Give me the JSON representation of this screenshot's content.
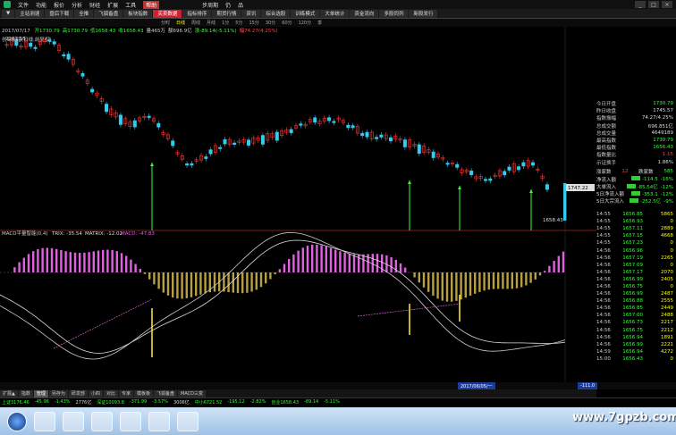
{
  "menubar": {
    "items": [
      "文件",
      "功能",
      "报价",
      "分析",
      "财经",
      "扩展",
      "工具",
      "帮助"
    ],
    "active_item": "帮助",
    "right_items": [
      "步周期",
      "仍",
      "品"
    ],
    "window_controls": [
      "_",
      "□",
      "×"
    ]
  },
  "funcbar": {
    "tabs": [
      "▼",
      "主站测速",
      "盘后下载",
      "全推",
      "飞狐备盘",
      "板块指数",
      "买卖数据",
      "指标排序",
      "期货行情",
      "资讯",
      "综合选股",
      "训练模式",
      "大单统计",
      "资金流向",
      "多股同列",
      "新股发行"
    ],
    "highlight": "买卖数据"
  },
  "periodbar": {
    "items": [
      "分时",
      "日线",
      "周线",
      "月线",
      "1分",
      "5分",
      "15分",
      "30分",
      "60分",
      "120分",
      "季"
    ],
    "selected": "日线"
  },
  "infoline": {
    "date": "2017/07/17",
    "items": [
      {
        "t": "开1730.79",
        "c": "g"
      },
      {
        "t": "高1730.79",
        "c": "g"
      },
      {
        "t": "低1658.43",
        "c": "g"
      },
      {
        "t": "收1658.43",
        "c": "g"
      },
      {
        "t": "量465万",
        "c": "w"
      },
      {
        "t": "额696.9亿",
        "c": "w"
      },
      {
        "t": "涨-89.14(-5.11%)",
        "c": "g"
      },
      {
        "t": "幅74.27(4.25%)",
        "c": "r"
      }
    ]
  },
  "chartlabel": "创业板指(日线,前复权)",
  "main_chart": {
    "high_label": "2201.55",
    "low_label": "1658.43",
    "last_label": "1747.22"
  },
  "macd_label": {
    "name": "MACD平量智能(0,4)",
    "trix": "TRIX: -35.54",
    "matrix": "MATRIX: -12.02",
    "macd": "MACD: -47.83"
  },
  "rpanel": {
    "rows": [
      {
        "k": "今日开盘",
        "v": "1730.79",
        "c": "grn"
      },
      {
        "k": "昨日收盘",
        "v": "1745.57",
        "c": "wht"
      },
      {
        "k": "指数振幅",
        "v": "74.27/4.25%",
        "c": "wht"
      },
      {
        "k": "总成交额",
        "v": "696.851亿",
        "c": "wht"
      },
      {
        "k": "总成交量",
        "v": "4649189",
        "c": "wht"
      },
      {
        "k": "最高指数",
        "v": "1730.79",
        "c": "grn"
      },
      {
        "k": "最低指数",
        "v": "1656.43",
        "c": "grn"
      },
      {
        "k": "指数量比",
        "v": "1.15",
        "c": "red"
      },
      {
        "k": "示证换手",
        "v": "1.86%",
        "c": "wht"
      }
    ],
    "updown": {
      "up_label": "涨家数",
      "up": "12",
      "down_label": "跌家数",
      "down": "585"
    },
    "flows": [
      {
        "k": "净流入额",
        "v": "-114.5",
        "pct": "-16%"
      },
      {
        "k": "大单流入",
        "v": "-85.54亿",
        "pct": "-12%"
      },
      {
        "k": "5日净流入额",
        "v": "-353.1",
        "pct": "-12%"
      },
      {
        "k": "5日大宗流入",
        "v": "-252.5亿",
        "pct": "-9%"
      }
    ]
  },
  "ticks": [
    {
      "t": "14:55",
      "p": "1656.85",
      "v": "5865"
    },
    {
      "t": "14:55",
      "p": "1656.93",
      "v": "0"
    },
    {
      "t": "14:55",
      "p": "1657.11",
      "v": "2889"
    },
    {
      "t": "14:55",
      "p": "1657.15",
      "v": "4668"
    },
    {
      "t": "14:55",
      "p": "1657.23",
      "v": "0"
    },
    {
      "t": "14:56",
      "p": "1656.96",
      "v": "0"
    },
    {
      "t": "14:56",
      "p": "1657.19",
      "v": "2265"
    },
    {
      "t": "14:56",
      "p": "1657.09",
      "v": "0"
    },
    {
      "t": "14:56",
      "p": "1657.17",
      "v": "2070"
    },
    {
      "t": "14:56",
      "p": "1656.99",
      "v": "2405"
    },
    {
      "t": "14:56",
      "p": "1656.75",
      "v": "0"
    },
    {
      "t": "14:56",
      "p": "1656.99",
      "v": "2487"
    },
    {
      "t": "14:56",
      "p": "1656.88",
      "v": "2555"
    },
    {
      "t": "14:56",
      "p": "1656.85",
      "v": "2449"
    },
    {
      "t": "14:56",
      "p": "1657.00",
      "v": "2488"
    },
    {
      "t": "14:56",
      "p": "1656.73",
      "v": "2217"
    },
    {
      "t": "14:56",
      "p": "1656.75",
      "v": "2212"
    },
    {
      "t": "14:56",
      "p": "1656.94",
      "v": "1891"
    },
    {
      "t": "14:56",
      "p": "1656.99",
      "v": "2221"
    },
    {
      "t": "14:59",
      "p": "1656.94",
      "v": "4272"
    },
    {
      "t": "15:00",
      "p": "1656.43",
      "v": "0"
    }
  ],
  "xaxis": {
    "date_box": "2017/06/05/一",
    "minute_box": "-111.0"
  },
  "bottom_tabs": [
    "扩展▲",
    "指数",
    "管理",
    "另存为",
    "研发部",
    "小四",
    "对比",
    "专家",
    "模板板",
    "飞狐备盘",
    "MACD三变"
  ],
  "bottom_tab_selected": "管理",
  "statusbar": [
    {
      "t": "上证3176.46",
      "c": "g"
    },
    {
      "t": "-45.96",
      "c": "g"
    },
    {
      "t": "-1.43%",
      "c": "g"
    },
    {
      "t": "2776亿",
      "c": "w"
    },
    {
      "t": "深证10093.8",
      "c": "g"
    },
    {
      "t": "-371.99",
      "c": "g"
    },
    {
      "t": "-3.57%",
      "c": "g"
    },
    {
      "t": "3006亿",
      "c": "w"
    },
    {
      "t": "中小6721.52",
      "c": "g"
    },
    {
      "t": "-195.12",
      "c": "g"
    },
    {
      "t": "-2.82%",
      "c": "g"
    },
    {
      "t": "创业1658.43",
      "c": "g"
    },
    {
      "t": "-89.14",
      "c": "g"
    },
    {
      "t": "-5.11%",
      "c": "g"
    }
  ],
  "watermark": "www.7gpzb.com",
  "colors": {
    "up": "#ff3333",
    "down": "#33ccee",
    "signal": "#33ff33",
    "macd_pos": "#e060e0",
    "macd_neg": "#b8a040",
    "accent": "#cc2233"
  }
}
